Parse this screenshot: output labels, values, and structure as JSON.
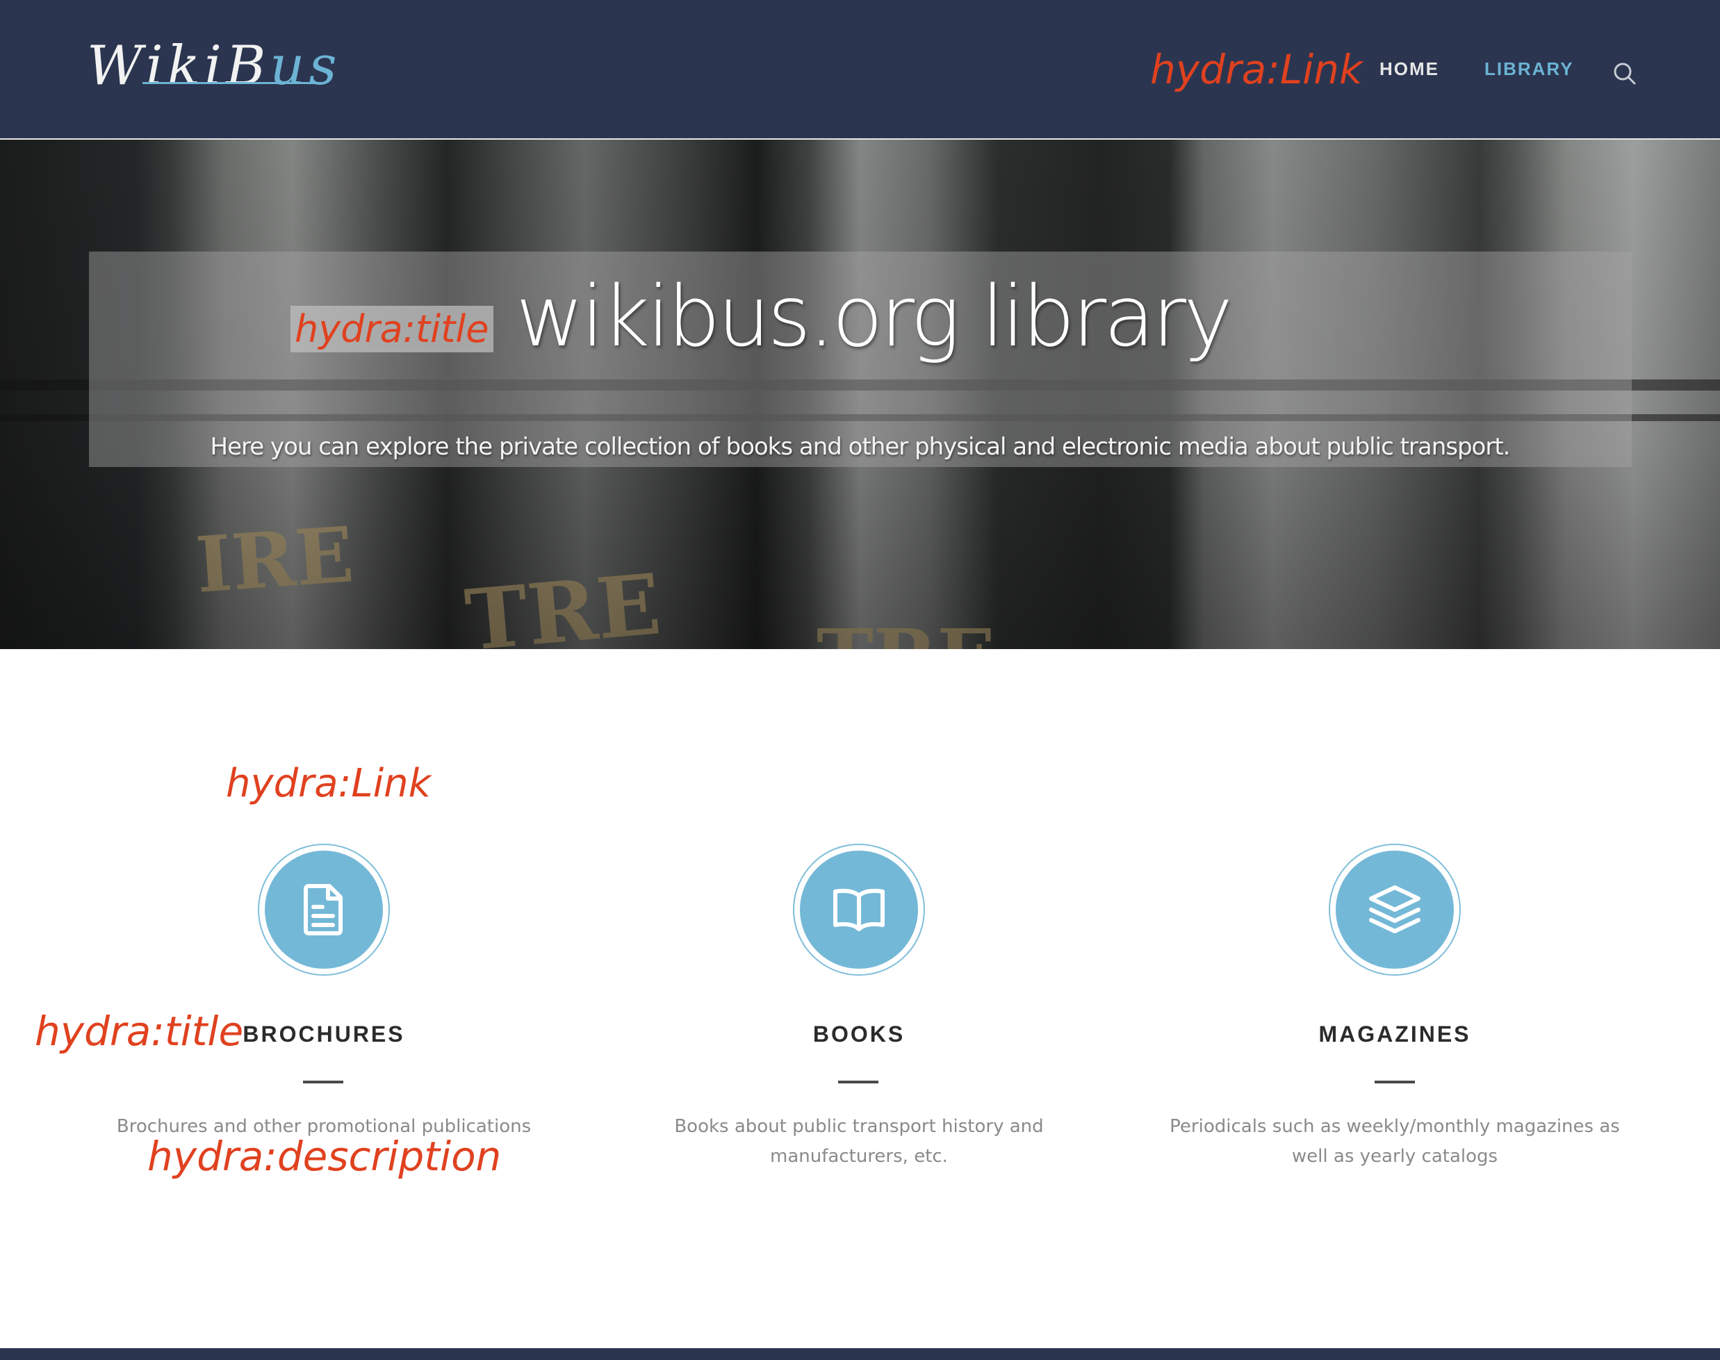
{
  "header": {
    "logo_part1": "WikiB",
    "logo_part2": "us",
    "nav": [
      {
        "label": "HOME"
      },
      {
        "label": "LIBRARY"
      }
    ]
  },
  "hero": {
    "title": "wikibus.org library",
    "subtitle": "Here you can explore the private collection of books and other physical and electronic media about public transport."
  },
  "annotations": {
    "header_link": "hydra:Link",
    "hero_title": "hydra:title",
    "card_link": "hydra:Link",
    "card_title": "hydra:title",
    "card_description": "hydra:description"
  },
  "cards": [
    {
      "title": "BROCHURES",
      "description": "Brochures and other promotional publications",
      "icon": "document-icon"
    },
    {
      "title": "BOOKS",
      "description": "Books about public transport history and manufacturers, etc.",
      "icon": "open-book-icon"
    },
    {
      "title": "MAGAZINES",
      "description": "Periodicals such as weekly/monthly magazines as well as yearly catalogs",
      "icon": "layers-icon"
    }
  ],
  "colors": {
    "header_bg": "#2b3550",
    "accent": "#74b8d7",
    "annotation": "#e0411f"
  }
}
